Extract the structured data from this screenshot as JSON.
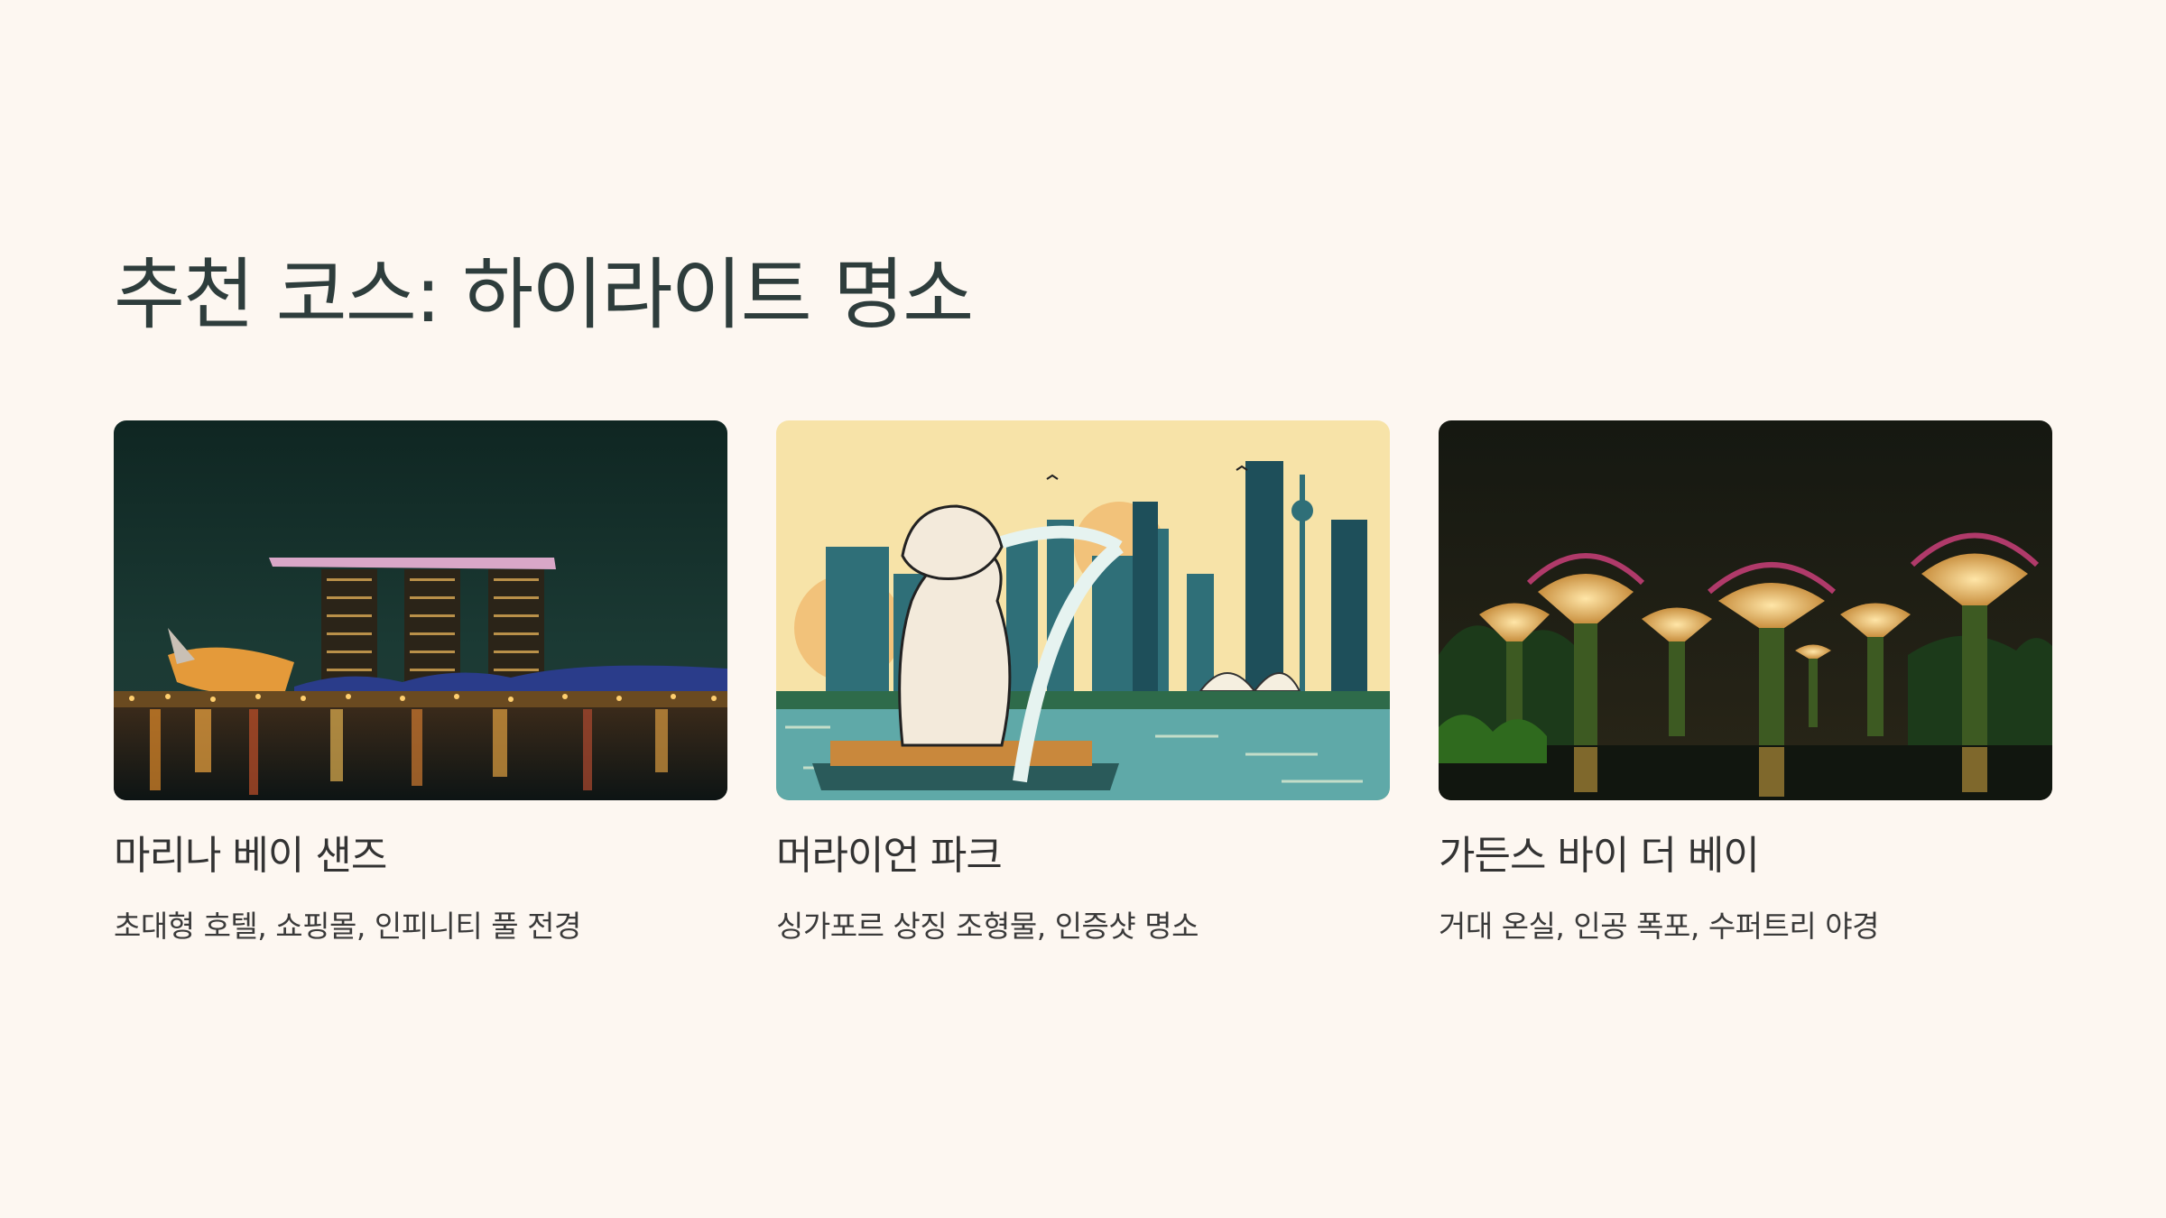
{
  "title": "추천 코스: 하이라이트 명소",
  "cards": [
    {
      "title": "마리나 베이 샌즈",
      "description": "초대형 호텔, 쇼핑몰, 인피니티 풀 전경",
      "image": "marina-bay-sands-night-photo"
    },
    {
      "title": "머라이언 파크",
      "description": "싱가포르 상징 조형물, 인증샷 명소",
      "image": "merlion-illustration"
    },
    {
      "title": "가든스 바이 더 베이",
      "description": "거대 온실, 인공 폭포, 수퍼트리 야경",
      "image": "supertree-grove-night-photo"
    }
  ],
  "colors": {
    "background": "#fdf7f1",
    "title": "#2e3d3c"
  }
}
